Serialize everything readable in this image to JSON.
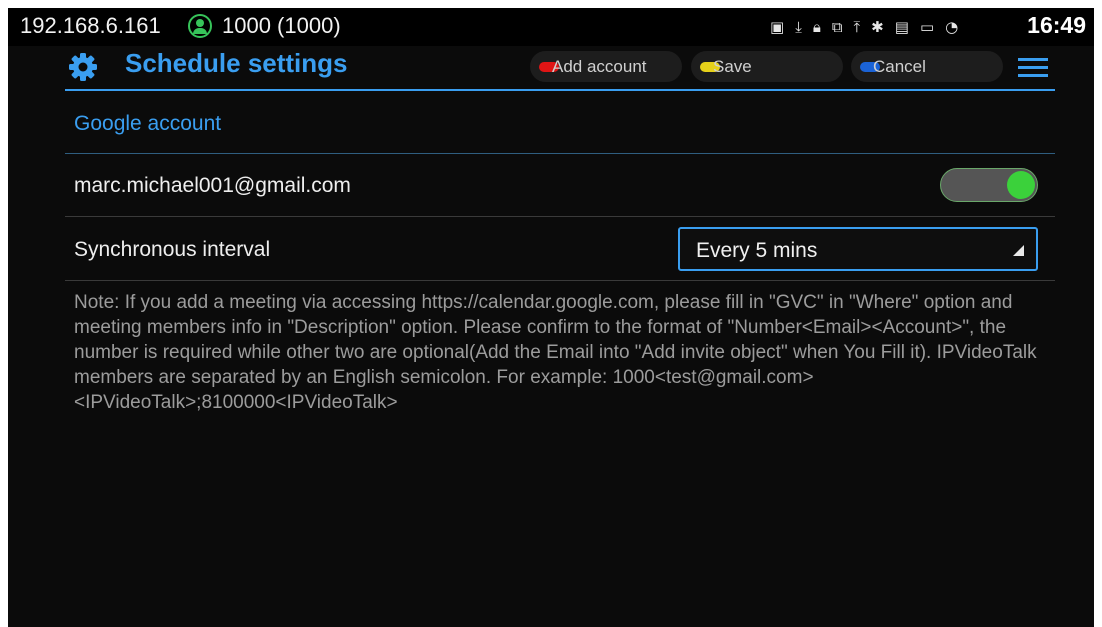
{
  "status_bar": {
    "ip": "192.168.6.161",
    "account_icon": "account-icon",
    "account": "1000 (1000)",
    "icons": [
      "picture-icon",
      "download-icon",
      "lock-icon",
      "network-icon",
      "upload-icon",
      "bluetooth-icon",
      "sim-icon",
      "monitor-icon",
      "wifi-icon"
    ],
    "time": "16:49"
  },
  "header": {
    "title": "Schedule settings",
    "title_icon": "gear-icon",
    "accent_color": "#3a9ef0",
    "softkeys": {
      "add_account": {
        "label": "Add account",
        "color": "#e01515"
      },
      "save": {
        "label": "Save",
        "color": "#e6d11a"
      },
      "cancel": {
        "label": "Cancel",
        "color": "#1b63d6"
      }
    },
    "menu_icon": "hamburger-menu-icon"
  },
  "main": {
    "section_title": "Google account",
    "account": {
      "email": "marc.michael001@gmail.com",
      "enabled": true
    },
    "sync_interval": {
      "label": "Synchronous interval",
      "value": "Every 5 mins"
    },
    "note": "Note: If you add a meeting via accessing https://calendar.google.com, please fill in \"GVC\" in \"Where\" option and meeting members info in \"Description\" option. Please confirm to the format of \"Number<Email><Account>\", the number is required while other two are optional(Add the Email into \"Add invite object\" when You Fill it). IPVideoTalk members are separated by an English semicolon. For example: 1000<test@gmail.com><IPVideoTalk>;8100000<IPVideoTalk>"
  }
}
